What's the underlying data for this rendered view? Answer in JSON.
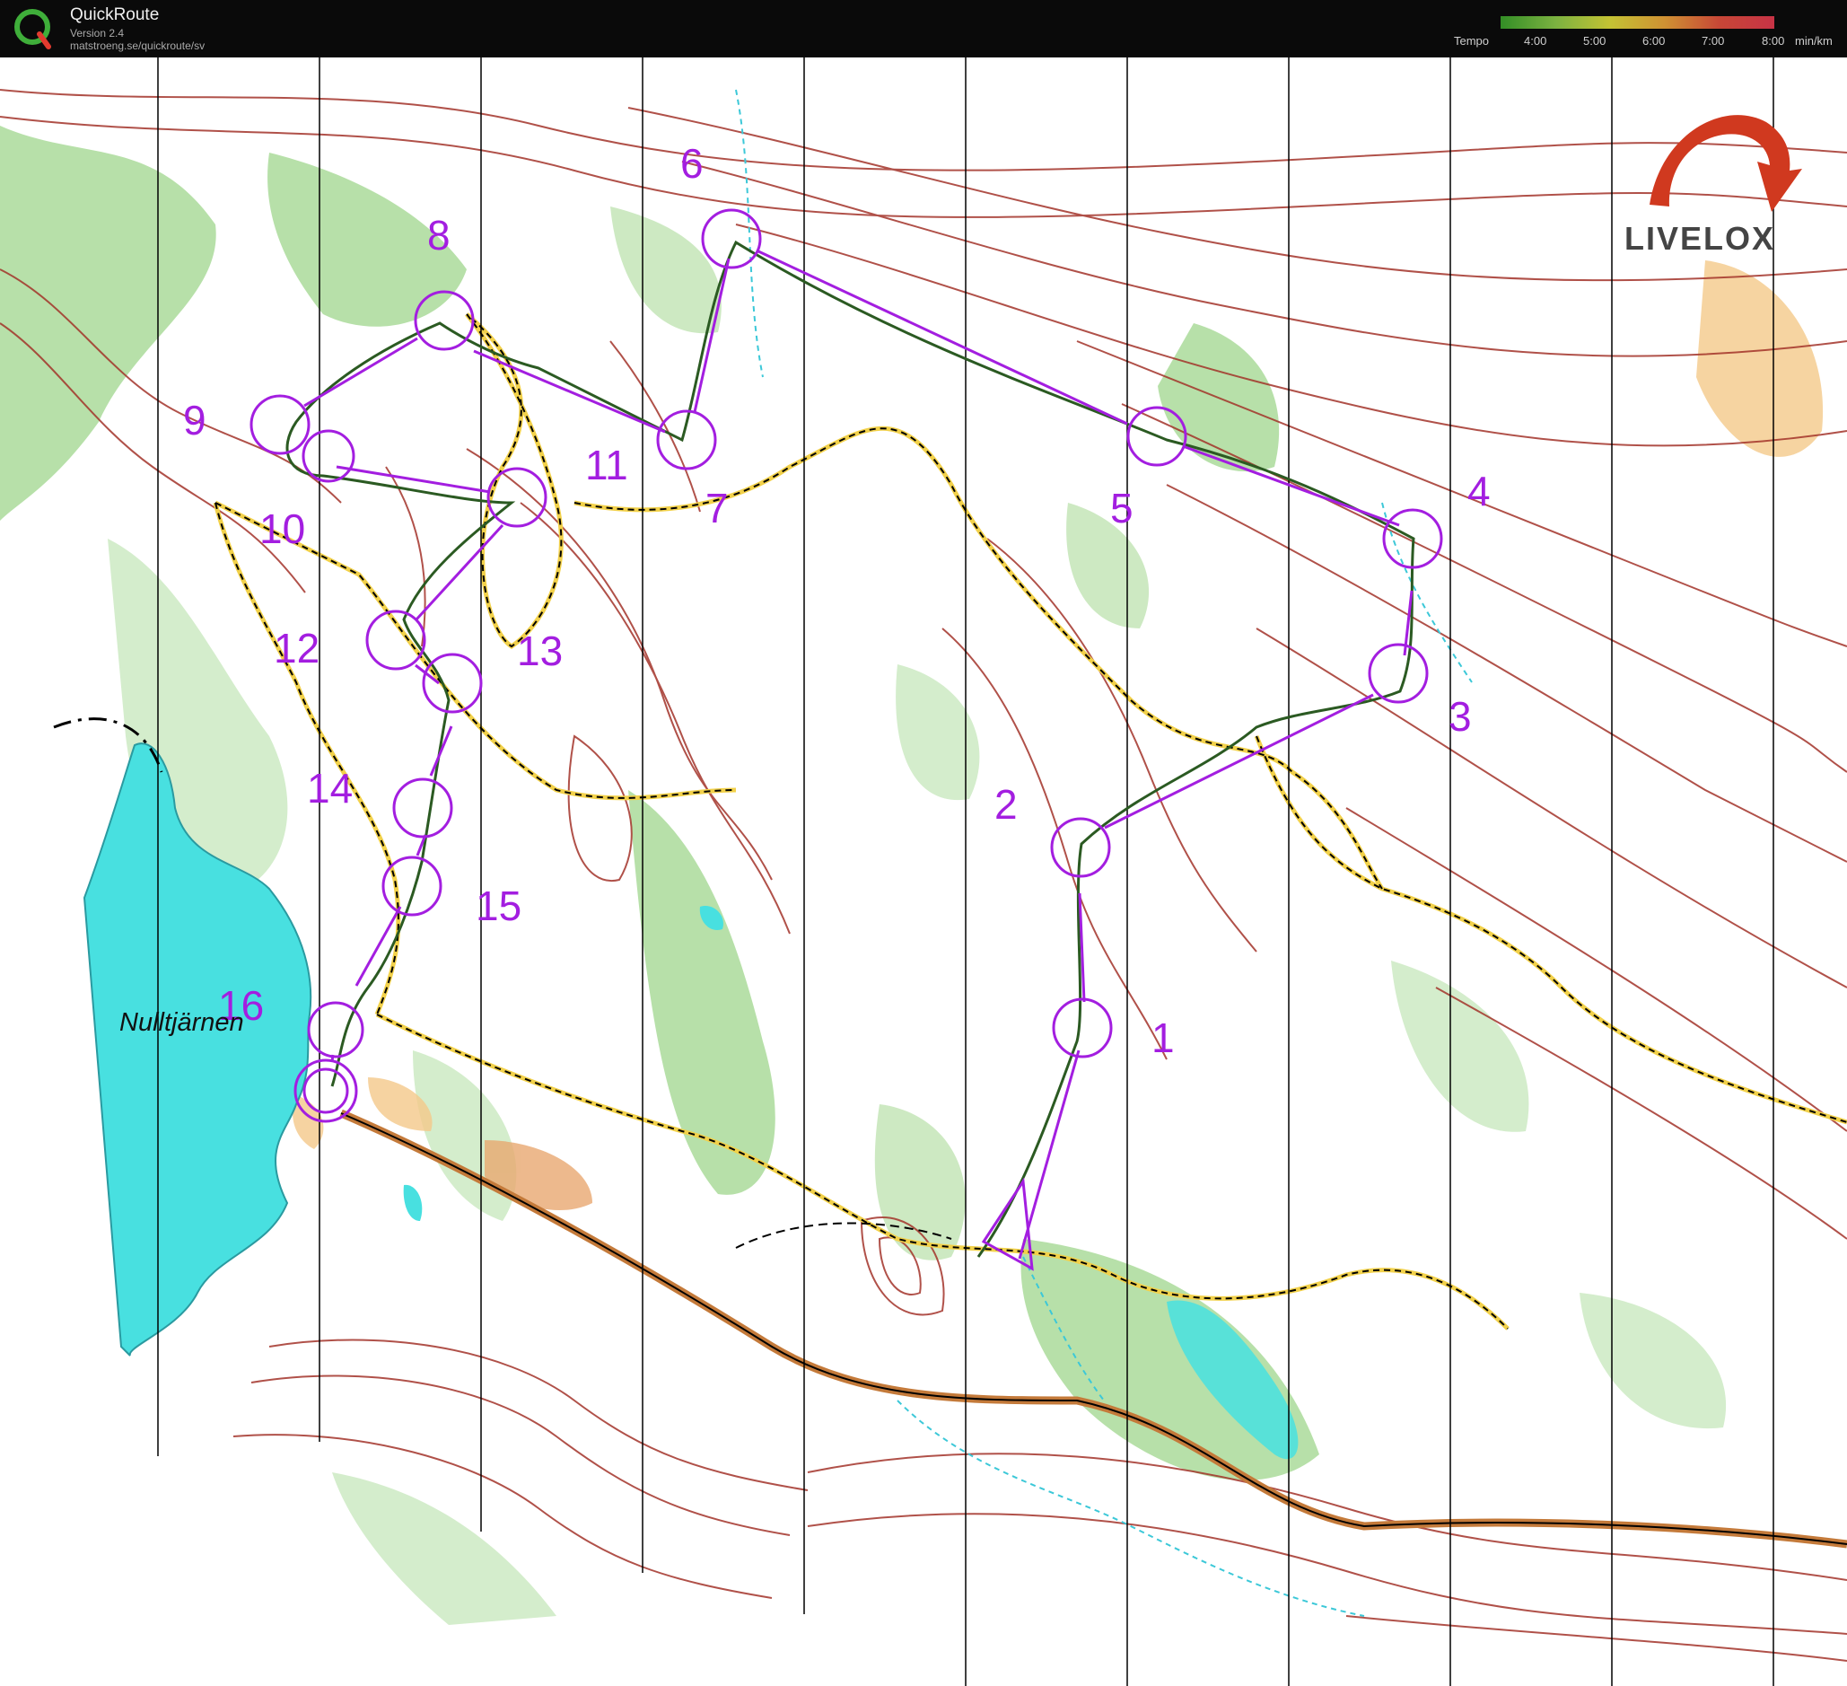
{
  "app": {
    "title": "QuickRoute",
    "version": "Version 2.4",
    "url": "matstroeng.se/quickroute/sv",
    "logo_letter": "Q"
  },
  "tempo_scale": {
    "label": "Tempo",
    "ticks": [
      "4:00",
      "5:00",
      "6:00",
      "7:00",
      "8:00"
    ],
    "unit": "min/km",
    "colors": [
      "#3aa52b",
      "#8fcf4a",
      "#e5e33b",
      "#f2a93a",
      "#e8513e",
      "#e83a50"
    ]
  },
  "watermark": {
    "brand": "LIVELOX"
  },
  "map": {
    "lake_label": "Nulltjärnen",
    "course_color": "#a31ee0",
    "route_color": "#2b5a22",
    "contour_color": "#a3332a",
    "vegetation_color": "#9fd68c",
    "water_color": "#48e0e0",
    "controls": [
      "1",
      "2",
      "3",
      "4",
      "5",
      "6",
      "7",
      "8",
      "9",
      "10",
      "11",
      "12",
      "13",
      "14",
      "15",
      "16"
    ]
  }
}
